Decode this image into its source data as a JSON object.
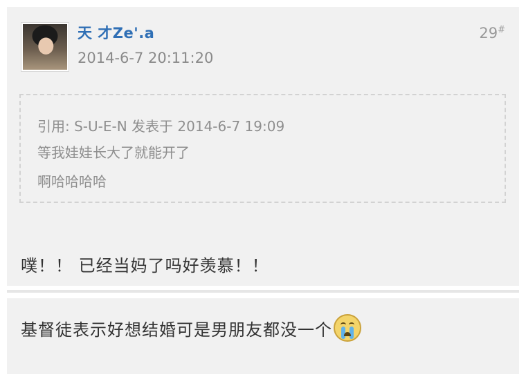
{
  "post": {
    "username": "天 才Ze'.a",
    "timestamp": "2014-6-7 20:11:20",
    "floor": "29",
    "floor_mark": "#",
    "avatar_icon": "user-avatar",
    "quote": {
      "header": "引用: S-U-E-N 发表于 2014-6-7 19:09",
      "lines": [
        "等我娃娃长大了就能开了",
        "啊哈哈哈哈"
      ]
    },
    "reply": "噗！！ 已经当妈了吗好羡慕！！"
  },
  "post2": {
    "text": "基督徒表示好想结婚可是男朋友都没一个",
    "emoji": "crying-face-icon"
  }
}
